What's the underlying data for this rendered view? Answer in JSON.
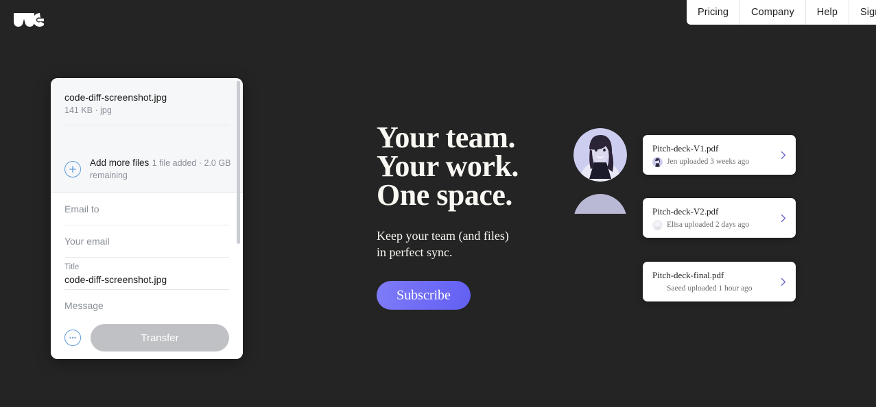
{
  "page": {
    "background_color": "#242424",
    "brand": "WeTransfer",
    "logo_icon": "wetransfer-we-logo"
  },
  "topnav": {
    "background_color": "#ffffff",
    "items": [
      {
        "label": "Pricing",
        "name": "nav-item-pricing"
      },
      {
        "label": "Company",
        "name": "nav-item-company"
      },
      {
        "label": "Help",
        "name": "nav-item-help"
      },
      {
        "label": "Sign up",
        "name": "nav-item-signup"
      }
    ]
  },
  "transfer_panel": {
    "file": {
      "name": "code-diff-screenshot.jpg",
      "meta": "141 KB · jpg"
    },
    "add_more": {
      "icon": "plus-circle-icon",
      "title": "Add more files",
      "subtitle": "1 file added · 2.0 GB remaining",
      "accent_color": "#5b9bd8"
    },
    "fields": {
      "email_to_placeholder": "Email to",
      "your_email_placeholder": "Your email",
      "title_label": "Title",
      "title_value": "code-diff-screenshot.jpg",
      "message_placeholder": "Message"
    },
    "footer": {
      "more_options_icon": "ellipsis-circle-icon",
      "transfer_label": "Transfer",
      "transfer_disabled_color": "#bfc1c4"
    },
    "scrollbar": {
      "name": "panel-scrollbar",
      "thumb_color": "#c9ccd1"
    }
  },
  "hero": {
    "title_line_1": "Your team.",
    "title_line_2": "Your work.",
    "title_line_3": "One space.",
    "subtitle_line_1": "Keep your team (and files)",
    "subtitle_line_2": "in perfect sync.",
    "subscribe_label": "Subscribe",
    "subscribe_color": "#6b68f5"
  },
  "avatars": {
    "primary": "portrait-photo-avatar",
    "secondary": "portrait-photo-avatar-partial"
  },
  "file_cards": [
    {
      "title": "Pitch-deck-V1.pdf",
      "meta": "Jen uploaded 3 weeks ago",
      "avatar": "user-avatar-jen",
      "chevron": "chevron-right-icon"
    },
    {
      "title": "Pitch-deck-V2.pdf",
      "meta": "Elisa uploaded 2 days ago",
      "avatar": "user-avatar-elisa",
      "chevron": "chevron-right-icon"
    },
    {
      "title": "Pitch-deck-final.pdf",
      "meta": "Saeed uploaded 1 hour ago",
      "avatar": "user-avatar-saeed",
      "chevron": "chevron-right-icon"
    }
  ]
}
